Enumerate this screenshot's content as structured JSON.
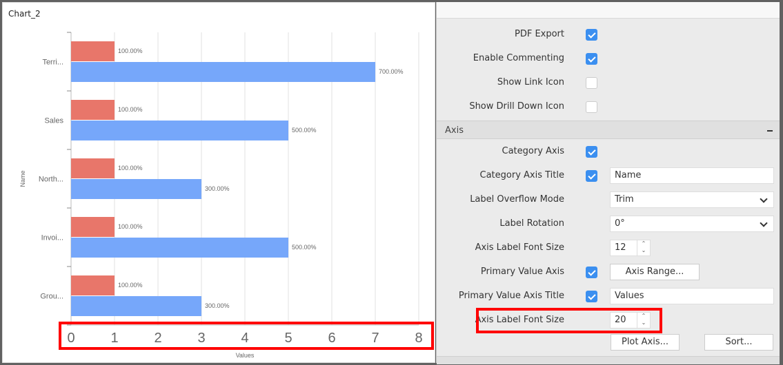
{
  "chart_panel": {
    "title": "Chart_2"
  },
  "chart_data": {
    "type": "bar",
    "orientation": "horizontal",
    "categories": [
      "Terri...",
      "Sales",
      "North...",
      "Invoi...",
      "Grou..."
    ],
    "series": [
      {
        "values": [
          1,
          1,
          1,
          1,
          1
        ],
        "labels": [
          "100.00%",
          "100.00%",
          "100.00%",
          "100.00%",
          "100.00%"
        ],
        "color": "#e8766a"
      },
      {
        "values": [
          7,
          5,
          3,
          5,
          3
        ],
        "labels": [
          "700.00%",
          "500.00%",
          "300.00%",
          "500.00%",
          "300.00%"
        ],
        "color": "#76a7fa"
      }
    ],
    "xlabel": "Values",
    "ylabel": "Name",
    "xlim": [
      0,
      8
    ],
    "xticks": [
      "0",
      "1",
      "2",
      "3",
      "4",
      "5",
      "6",
      "7",
      "8"
    ],
    "grid": true
  },
  "properties": {
    "rows_top": [
      {
        "label": "PDF Export",
        "checked": true
      },
      {
        "label": "Enable Commenting",
        "checked": true
      },
      {
        "label": "Show Link Icon",
        "checked": false
      },
      {
        "label": "Show Drill Down Icon",
        "checked": false
      }
    ],
    "axis_section": {
      "title": "Axis",
      "collapse_icon": "minus-icon"
    },
    "category_axis": {
      "label": "Category Axis",
      "checked": true
    },
    "category_axis_title": {
      "label": "Category Axis Title",
      "checked": true,
      "value": "Name"
    },
    "label_overflow_mode": {
      "label": "Label Overflow Mode",
      "value": "Trim"
    },
    "label_rotation": {
      "label": "Label Rotation",
      "value": "0°"
    },
    "axis_label_font_size_cat": {
      "label": "Axis Label Font Size",
      "value": "12"
    },
    "primary_value_axis": {
      "label": "Primary Value Axis",
      "checked": true,
      "button": "Axis Range..."
    },
    "primary_value_axis_title": {
      "label": "Primary Value Axis Title",
      "checked": true,
      "value": "Values"
    },
    "axis_label_font_size_val": {
      "label": "Axis Label Font Size",
      "value": "20"
    },
    "plot_axis_button": "Plot Axis...",
    "sort_button": "Sort..."
  }
}
